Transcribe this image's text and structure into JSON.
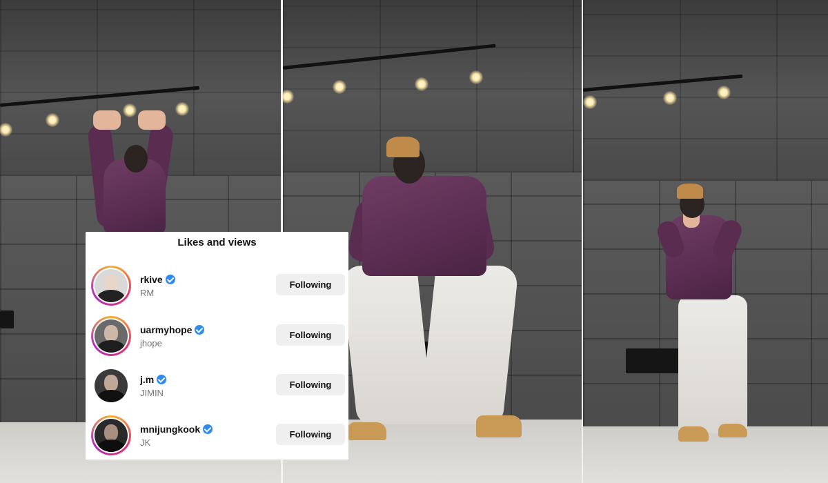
{
  "overlay": {
    "title": "Likes and views",
    "users": [
      {
        "username": "rkive",
        "display_name": "RM",
        "verified": true,
        "story_ring": true,
        "button_label": "Following"
      },
      {
        "username": "uarmyhope",
        "display_name": "jhope",
        "verified": true,
        "story_ring": true,
        "button_label": "Following"
      },
      {
        "username": "j.m",
        "display_name": "JIMIN",
        "verified": true,
        "story_ring": false,
        "button_label": "Following"
      },
      {
        "username": "mnijungkook",
        "display_name": "JK",
        "verified": true,
        "story_ring": true,
        "button_label": "Following"
      }
    ]
  },
  "colors": {
    "verified_badge": "#2f8bf0",
    "button_bg": "#efefef",
    "jacket": "#5b2d52",
    "pants": "#e3e0dc",
    "story_ring": [
      "#f8b52c",
      "#e5346e",
      "#b02ec4"
    ]
  },
  "icons": {
    "verified": "verified-badge-icon"
  }
}
